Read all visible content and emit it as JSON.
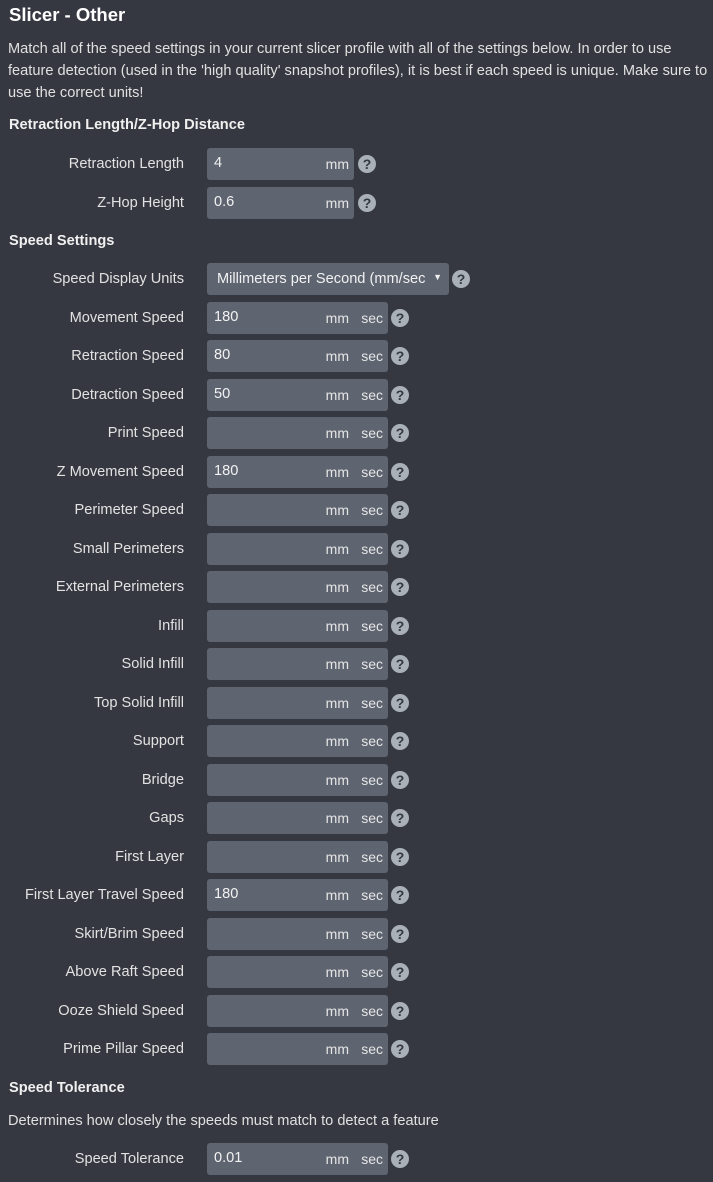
{
  "title": "Slicer - Other",
  "description": "Match all of the speed settings in your current slicer profile with all of the settings below. In order to use feature detection (used in the 'high quality' snapshot profiles), it is best if each speed is unique. Make sure to use the correct units!",
  "units": {
    "mm": "mm",
    "sec": "sec"
  },
  "help_icon": "question-circle-icon",
  "retraction": {
    "heading": "Retraction Length/Z-Hop Distance",
    "fields": [
      {
        "label": "Retraction Length",
        "value": "4"
      },
      {
        "label": "Z-Hop Height",
        "value": "0.6"
      }
    ]
  },
  "speed": {
    "heading": "Speed Settings",
    "display_units": {
      "label": "Speed Display Units",
      "value": "Millimeters per Second (mm/sec)"
    },
    "fields": [
      {
        "label": "Movement Speed",
        "value": "180"
      },
      {
        "label": "Retraction Speed",
        "value": "80"
      },
      {
        "label": "Detraction Speed",
        "value": "50"
      },
      {
        "label": "Print Speed",
        "value": ""
      },
      {
        "label": "Z Movement Speed",
        "value": "180"
      },
      {
        "label": "Perimeter Speed",
        "value": ""
      },
      {
        "label": "Small Perimeters",
        "value": ""
      },
      {
        "label": "External Perimeters",
        "value": ""
      },
      {
        "label": "Infill",
        "value": ""
      },
      {
        "label": "Solid Infill",
        "value": ""
      },
      {
        "label": "Top Solid Infill",
        "value": ""
      },
      {
        "label": "Support",
        "value": ""
      },
      {
        "label": "Bridge",
        "value": ""
      },
      {
        "label": "Gaps",
        "value": ""
      },
      {
        "label": "First Layer",
        "value": ""
      },
      {
        "label": "First Layer Travel Speed",
        "value": "180"
      },
      {
        "label": "Skirt/Brim Speed",
        "value": ""
      },
      {
        "label": "Above Raft Speed",
        "value": ""
      },
      {
        "label": "Ooze Shield Speed",
        "value": ""
      },
      {
        "label": "Prime Pillar Speed",
        "value": ""
      }
    ]
  },
  "tolerance": {
    "heading": "Speed Tolerance",
    "description": "Determines how closely the speeds must match to detect a feature",
    "field": {
      "label": "Speed Tolerance",
      "value": "0.01"
    }
  }
}
